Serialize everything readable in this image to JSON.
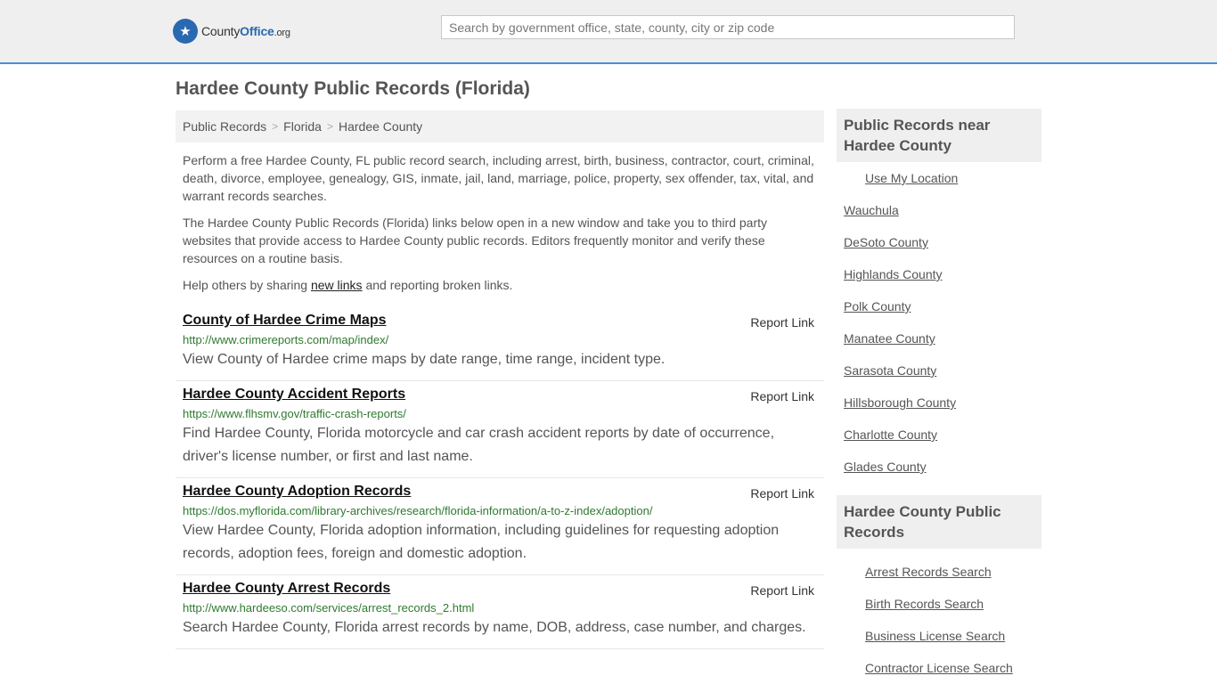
{
  "header": {
    "logo": {
      "name_a": "County",
      "name_b": "Office",
      "tld": ".org",
      "icon": "star-shield-icon"
    },
    "search": {
      "placeholder": "Search by government office, state, county, city or zip code"
    }
  },
  "page_title": "Hardee County Public Records (Florida)",
  "breadcrumb": [
    "Public Records",
    "Florida",
    "Hardee County"
  ],
  "intro": {
    "p1": "Perform a free Hardee County, FL public record search, including arrest, birth, business, contractor, court, criminal, death, divorce, employee, genealogy, GIS, inmate, jail, land, marriage, police, property, sex offender, tax, vital, and warrant records searches.",
    "p2": "The Hardee County Public Records (Florida) links below open in a new window and take you to third party websites that provide access to Hardee County public records. Editors frequently monitor and verify these resources on a routine basis.",
    "p3_before": "Help others by sharing ",
    "p3_link": "new links",
    "p3_after": " and reporting broken links."
  },
  "records": [
    {
      "title": "County of Hardee Crime Maps",
      "url": "http://www.crimereports.com/map/index/",
      "desc": "View County of Hardee crime maps by date range, time range, incident type.",
      "report": "Report Link"
    },
    {
      "title": "Hardee County Accident Reports",
      "url": "https://www.flhsmv.gov/traffic-crash-reports/",
      "desc": "Find Hardee County, Florida motorcycle and car crash accident reports by date of occurrence, driver's license number, or first and last name.",
      "report": "Report Link"
    },
    {
      "title": "Hardee County Adoption Records",
      "url": "https://dos.myflorida.com/library-archives/research/florida-information/a-to-z-index/adoption/",
      "desc": "View Hardee County, Florida adoption information, including guidelines for requesting adoption records, adoption fees, foreign and domestic adoption.",
      "report": "Report Link"
    },
    {
      "title": "Hardee County Arrest Records",
      "url": "http://www.hardeeso.com/services/arrest_records_2.html",
      "desc": "Search Hardee County, Florida arrest records by name, DOB, address, case number, and charges.",
      "report": "Report Link"
    }
  ],
  "sidebar": {
    "nearby": {
      "heading": "Public Records near Hardee County",
      "use_location": "Use My Location",
      "items": [
        "Wauchula",
        "DeSoto County",
        "Highlands County",
        "Polk County",
        "Manatee County",
        "Sarasota County",
        "Hillsborough County",
        "Charlotte County",
        "Glades County"
      ]
    },
    "county": {
      "heading": "Hardee County Public Records",
      "items": [
        "Arrest Records Search",
        "Birth Records Search",
        "Business License Search",
        "Contractor License Search"
      ]
    }
  }
}
